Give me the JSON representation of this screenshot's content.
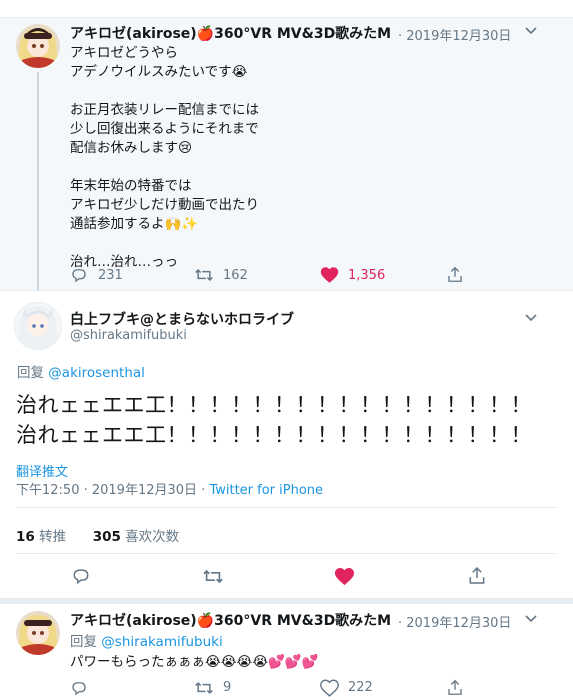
{
  "tweet1": {
    "name": "アキロゼ(akirose)🍎360°VR MV&3D歌みたM...",
    "date": "· 2019年12月30日",
    "body": "アキロゼどうやら\nアデノウイルスみたいです😭\n\nお正月衣装リレー配信までには\n少し回復出来るようにそれまで\n配信お休みします😢\n\n年末年始の特番では\nアキロゼ少しだけ動画で出たり\n通話参加するよ🙌✨\n\n治れ…治れ…っっ",
    "replies": "231",
    "retweets": "162",
    "likes": "1,356"
  },
  "main_tweet": {
    "name": "白上フブキ@とまらないホロライブ",
    "handle": "@shirakamifubuki",
    "reply_prefix": "回复",
    "reply_to": "@akirosenthal",
    "text": "治れェェエエ工！！！！！！！！！！！！！！！！！治れェェエエ工！！！！！！！！！！！！！！！！！",
    "translate": "翻译推文",
    "time_date": "下午12:50 · 2019年12月30日 · ",
    "source": "Twitter for iPhone",
    "retweet_count": "16",
    "retweet_label": "转推",
    "like_count": "305",
    "like_label": "喜欢次数"
  },
  "tweet3": {
    "name": "アキロゼ(akirose)🍎360°VR MV&3D歌みたM...",
    "date": "· 2019年12月30日",
    "reply_prefix": "回复",
    "reply_to": "@shirakamifubuki",
    "body": "パワーもらったぁぁぁ😭😭😭😭💕💕💕",
    "retweets": "9",
    "likes": "222"
  },
  "colors": {
    "like_active": "#e0245e",
    "link": "#1b95e0",
    "muted": "#657786"
  }
}
